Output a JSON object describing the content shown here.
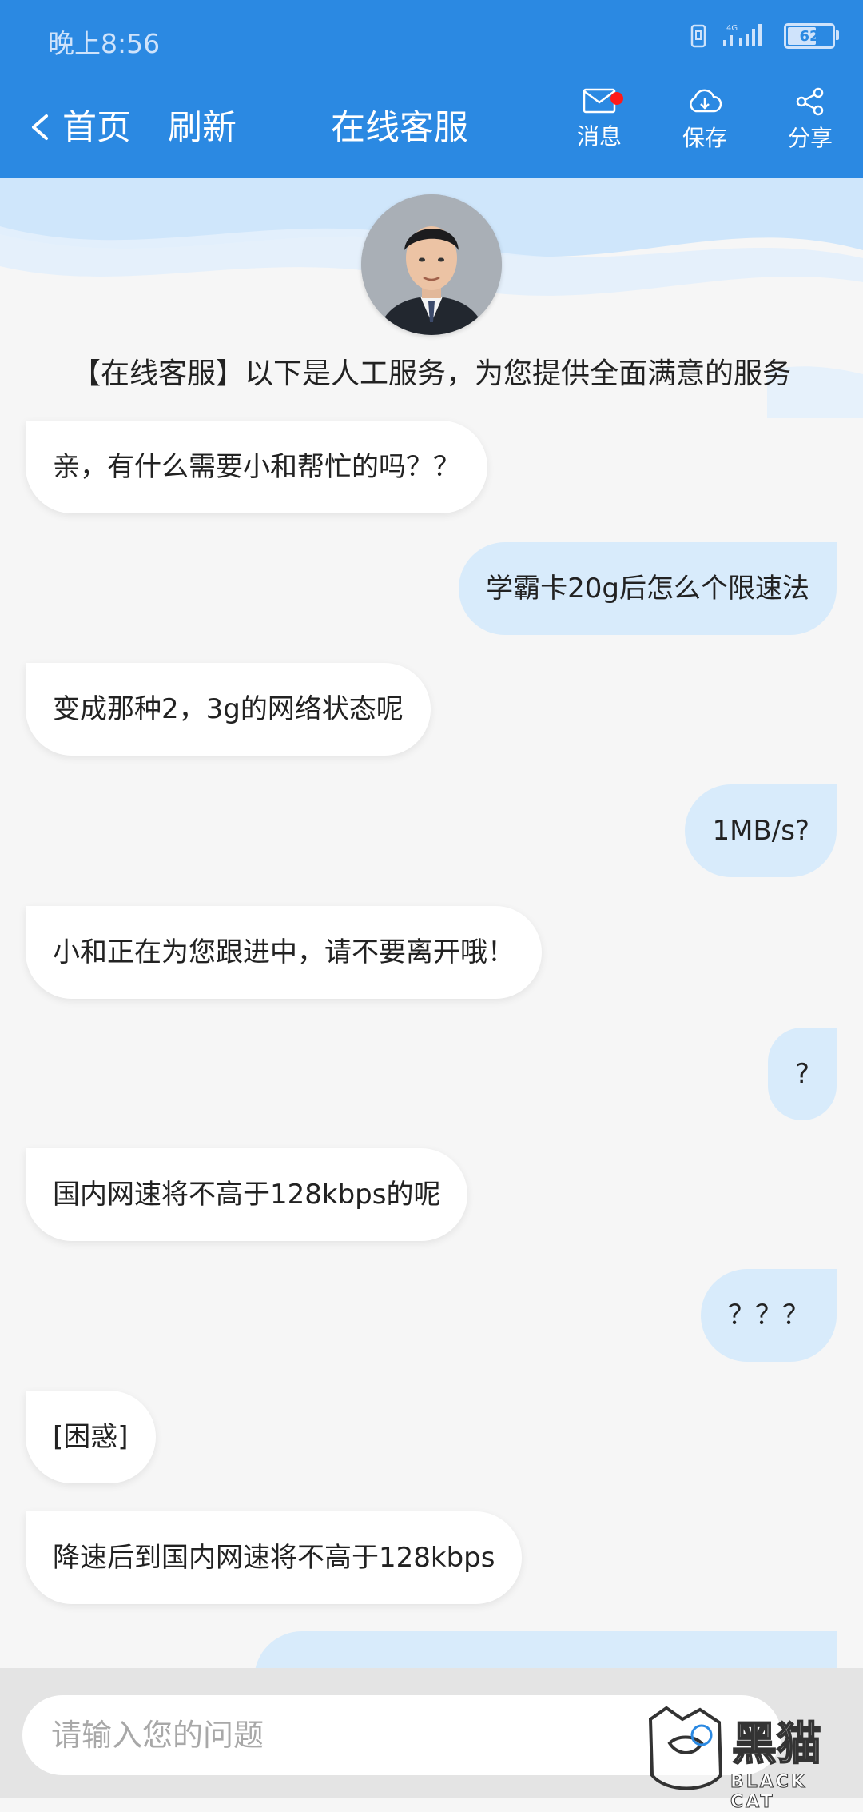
{
  "status_bar": {
    "time": "晚上8:56",
    "network": "4G",
    "battery": "62"
  },
  "nav": {
    "home": "首页",
    "refresh": "刷新",
    "title": "在线客服",
    "actions": {
      "message": "消息",
      "save": "保存",
      "share": "分享"
    }
  },
  "notice": "【在线客服】以下是人工服务，为您提供全面满意的服务",
  "messages": [
    {
      "side": "left",
      "text": "亲，有什么需要小和帮忙的吗？？"
    },
    {
      "side": "right",
      "text": "学霸卡20g后怎么个限速法"
    },
    {
      "side": "left",
      "text": "变成那种2，3g的网络状态呢"
    },
    {
      "side": "right",
      "text": "1MB/s?"
    },
    {
      "side": "left",
      "text": "小和正在为您跟进中，请不要离开哦！"
    },
    {
      "side": "right",
      "text": "?"
    },
    {
      "side": "left",
      "text": "国内网速将不高于128kbps的呢"
    },
    {
      "side": "right",
      "text": "？？？"
    },
    {
      "side": "left",
      "text": "[困惑]"
    },
    {
      "side": "left",
      "text": "降速后到国内网速将不高于128kbps"
    }
  ],
  "input": {
    "placeholder": "请输入您的问题"
  },
  "watermark": {
    "text": "黑猫",
    "sub": "BLACK CAT"
  },
  "colors": {
    "primary": "#2b89e2",
    "user_bubble": "#d8ebfb",
    "agent_bubble": "#ffffff",
    "badge": "#ff1a1a"
  }
}
